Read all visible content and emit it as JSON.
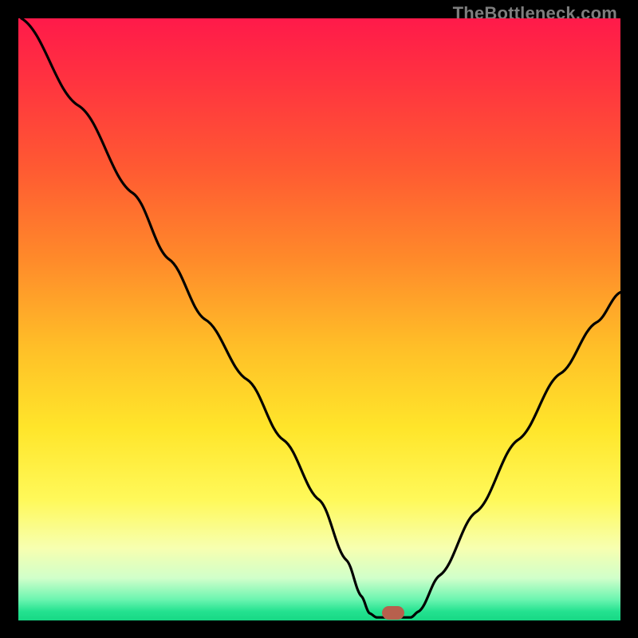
{
  "watermark": "TheBottleneck.com",
  "gradient": {
    "stops": [
      {
        "offset": 0.0,
        "color": "#ff1a4a"
      },
      {
        "offset": 0.1,
        "color": "#ff3240"
      },
      {
        "offset": 0.25,
        "color": "#ff5a32"
      },
      {
        "offset": 0.4,
        "color": "#ff8a2a"
      },
      {
        "offset": 0.55,
        "color": "#ffc028"
      },
      {
        "offset": 0.68,
        "color": "#ffe52a"
      },
      {
        "offset": 0.8,
        "color": "#fff95a"
      },
      {
        "offset": 0.88,
        "color": "#f7ffb0"
      },
      {
        "offset": 0.93,
        "color": "#d0ffca"
      },
      {
        "offset": 0.965,
        "color": "#6cf5b0"
      },
      {
        "offset": 0.985,
        "color": "#24e290"
      },
      {
        "offset": 1.0,
        "color": "#17d885"
      }
    ]
  },
  "marker": {
    "x_frac": 0.622,
    "y_frac": 0.987,
    "color": "#b7604d"
  },
  "chart_data": {
    "type": "line",
    "title": "",
    "xlabel": "",
    "ylabel": "",
    "xlim": [
      0,
      1
    ],
    "ylim": [
      0,
      1
    ],
    "series": [
      {
        "name": "curve",
        "points": [
          {
            "x": 0.005,
            "y": 1.0
          },
          {
            "x": 0.1,
            "y": 0.855
          },
          {
            "x": 0.19,
            "y": 0.71
          },
          {
            "x": 0.25,
            "y": 0.6
          },
          {
            "x": 0.31,
            "y": 0.5
          },
          {
            "x": 0.38,
            "y": 0.4
          },
          {
            "x": 0.44,
            "y": 0.3
          },
          {
            "x": 0.5,
            "y": 0.2
          },
          {
            "x": 0.545,
            "y": 0.1
          },
          {
            "x": 0.57,
            "y": 0.04
          },
          {
            "x": 0.583,
            "y": 0.012
          },
          {
            "x": 0.595,
            "y": 0.005
          },
          {
            "x": 0.625,
            "y": 0.005
          },
          {
            "x": 0.652,
            "y": 0.005
          },
          {
            "x": 0.665,
            "y": 0.015
          },
          {
            "x": 0.7,
            "y": 0.075
          },
          {
            "x": 0.76,
            "y": 0.18
          },
          {
            "x": 0.83,
            "y": 0.3
          },
          {
            "x": 0.9,
            "y": 0.41
          },
          {
            "x": 0.96,
            "y": 0.495
          },
          {
            "x": 1.0,
            "y": 0.545
          }
        ]
      }
    ]
  }
}
